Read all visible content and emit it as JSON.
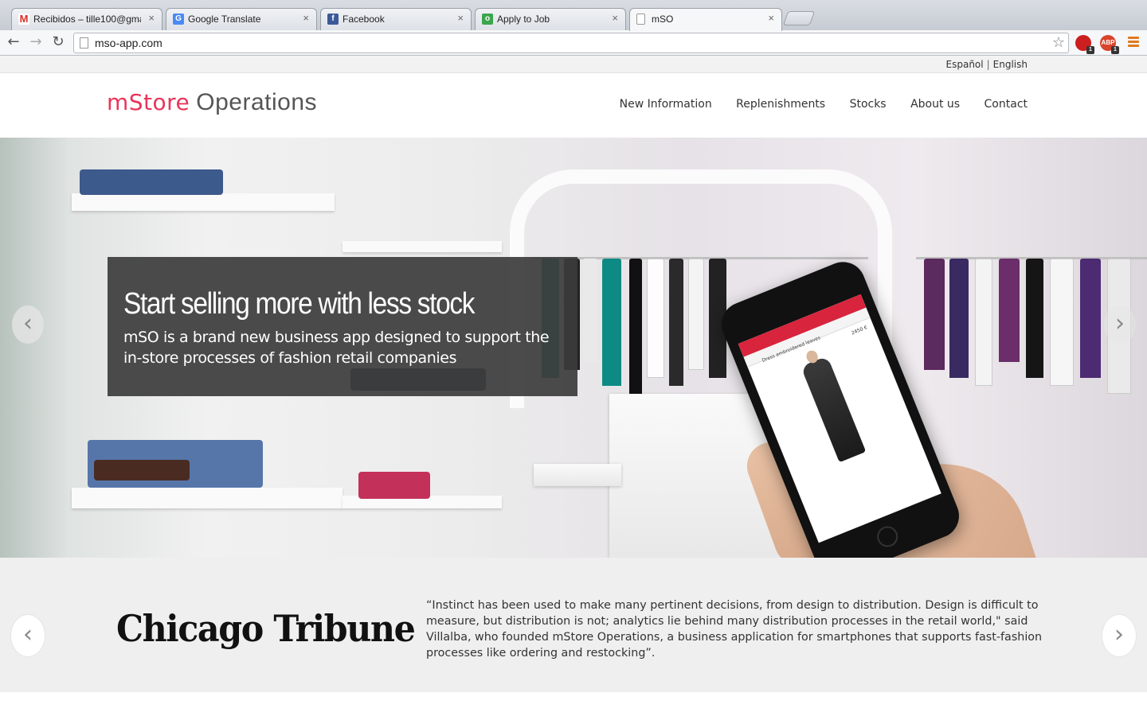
{
  "browser": {
    "tabs": [
      {
        "label": "Recibidos – tille100@gmail.com",
        "icon": "gmail-icon"
      },
      {
        "label": "Google Translate",
        "icon": "translate-icon"
      },
      {
        "label": "Facebook",
        "icon": "facebook-icon"
      },
      {
        "label": "Apply to Job",
        "icon": "job-icon"
      },
      {
        "label": "mSO",
        "icon": "page-icon"
      }
    ],
    "close_glyph": "×",
    "url": "mso-app.com",
    "extensions": [
      {
        "name": "adblock-stop-icon",
        "badge": "1",
        "text": "",
        "color": "#cc1f1f"
      },
      {
        "name": "abp-icon",
        "badge": "1",
        "text": "ABP",
        "color": "#d9442a"
      }
    ],
    "nav": {
      "back": "←",
      "forward": "→",
      "reload": "↻",
      "star": "☆"
    }
  },
  "lang": {
    "spanish": "Español",
    "separator": "|",
    "english": "English"
  },
  "header": {
    "logo_part1": "mStore",
    "logo_part2": "Operations",
    "nav": [
      "New Information",
      "Replenishments",
      "Stocks",
      "About us",
      "Contact"
    ]
  },
  "hero": {
    "title": "Start selling more with less stock",
    "subtitle": "mSO is a brand new business app designed to support the in-store processes of fashion retail companies",
    "prev": "‹",
    "next": "›",
    "phone_title": "Dress embroidered leaves",
    "phone_price": "2450 €"
  },
  "press": {
    "publication": "Chicago Tribune",
    "quote": "“Instinct has been used to make many pertinent decisions, from design to distribution. Design is difficult to measure, but distribution is not; analytics lie behind many distribution processes in the retail world,\" said Villalba, who founded mStore Operations, a business application for smartphones that supports fast-fashion processes like ordering and restocking”.",
    "prev": "‹",
    "next": "›"
  }
}
